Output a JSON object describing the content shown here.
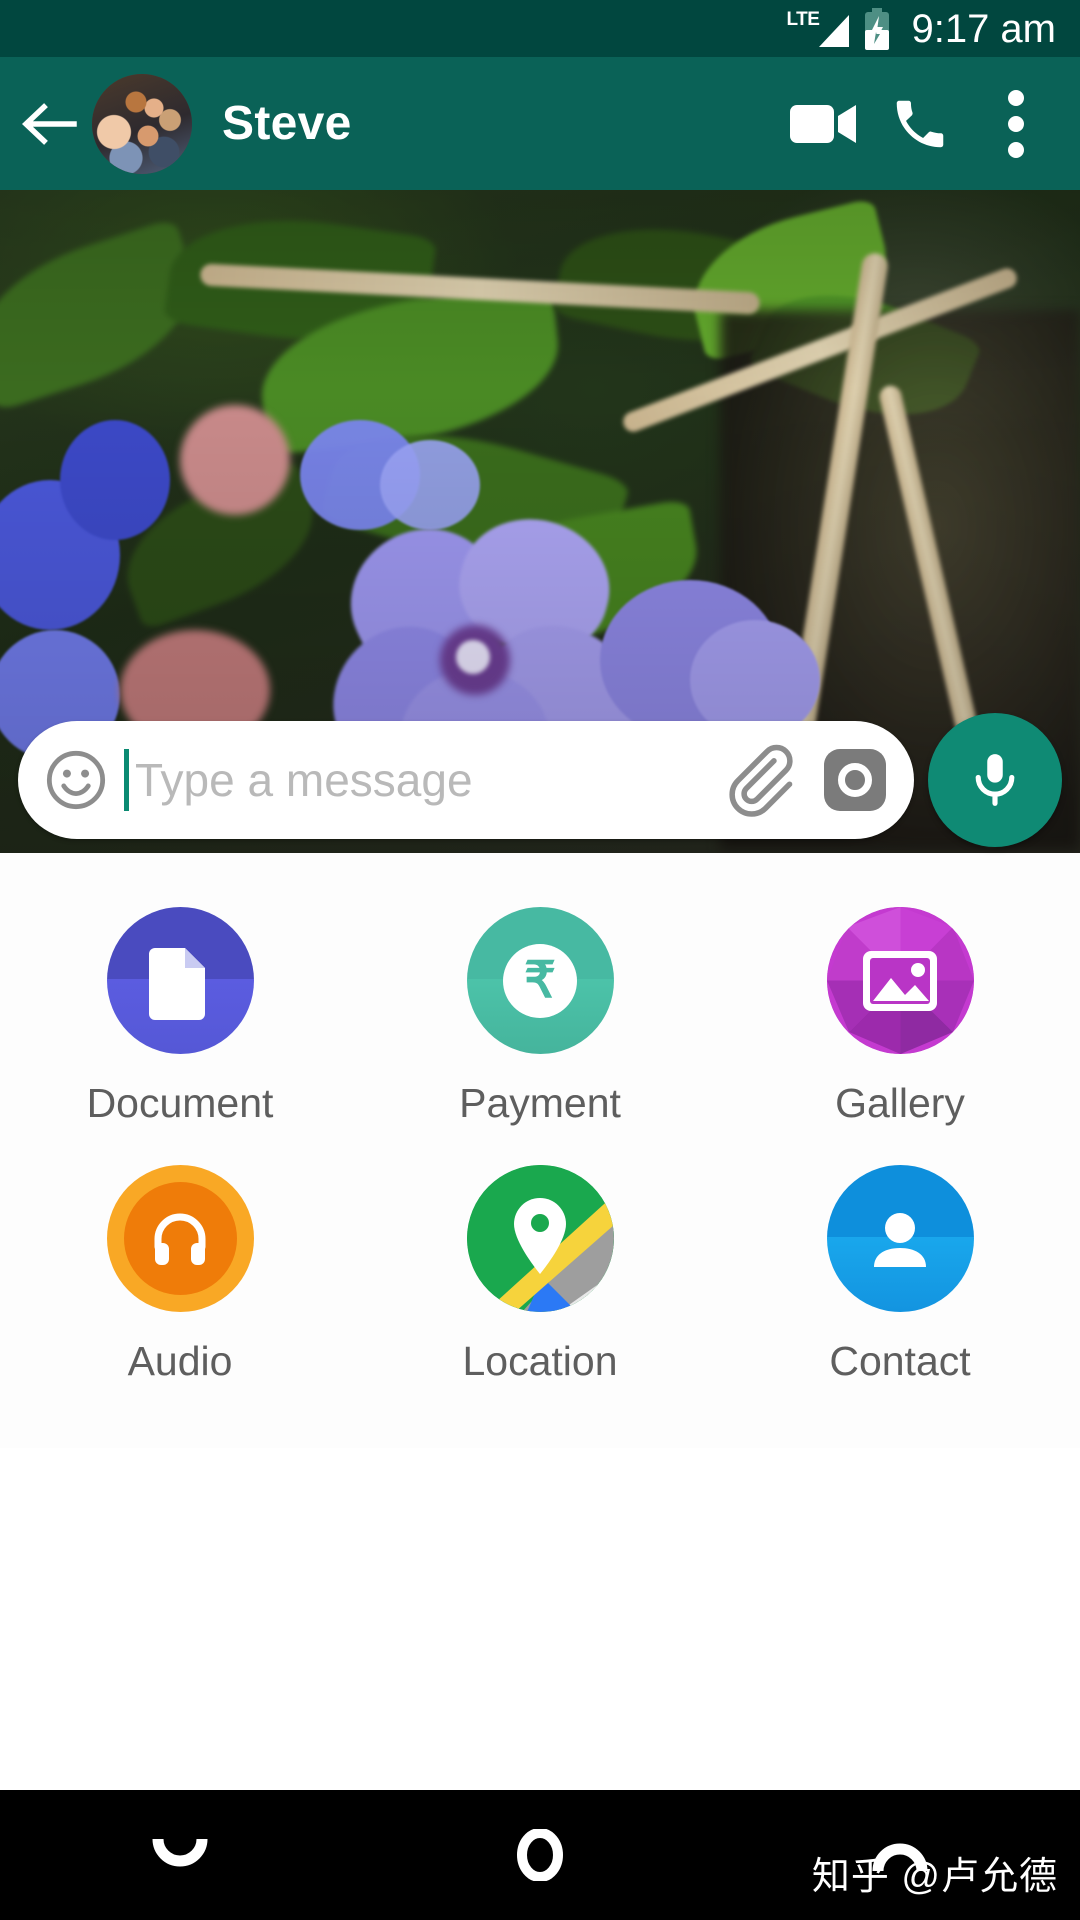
{
  "status_bar": {
    "network_label": "LTE",
    "signal_icon": "signal-triangle-icon",
    "battery_icon": "battery-charging-icon",
    "time": "9:17 am"
  },
  "app_bar": {
    "back_icon": "back-arrow-icon",
    "avatar_icon": "contact-avatar",
    "contact_name": "Steve",
    "actions": [
      {
        "name": "video-call-icon",
        "label": "Video call"
      },
      {
        "name": "voice-call-icon",
        "label": "Voice call"
      },
      {
        "name": "overflow-menu-icon",
        "label": "More options"
      }
    ]
  },
  "chat": {
    "wallpaper_description": "Photo of purple flowers with green leaves and branches"
  },
  "composer": {
    "emoji_icon": "emoji-smiley-icon",
    "placeholder": "Type a message",
    "value": "",
    "attach_icon": "paperclip-icon",
    "camera_icon": "camera-icon",
    "mic_icon": "microphone-icon"
  },
  "attachment_panel": {
    "items": [
      {
        "label": "Document",
        "icon": "document-icon",
        "color": "#4a4bbf"
      },
      {
        "label": "Payment",
        "icon": "rupee-payment-icon",
        "color": "#47b9a2",
        "symbol": "₹"
      },
      {
        "label": "Gallery",
        "icon": "gallery-image-icon",
        "color": "#b935c6"
      },
      {
        "label": "Audio",
        "icon": "headphones-icon",
        "color": "#f9a825"
      },
      {
        "label": "Location",
        "icon": "map-pin-icon",
        "color": "#1aa84e"
      },
      {
        "label": "Contact",
        "icon": "person-icon",
        "color": "#0e8fdc"
      }
    ]
  },
  "nav_bar": {
    "back_icon": "nav-back-icon",
    "home_icon": "nav-home-icon",
    "recents_icon": "nav-recents-icon"
  },
  "watermark": {
    "text": "知乎 @卢允德"
  }
}
